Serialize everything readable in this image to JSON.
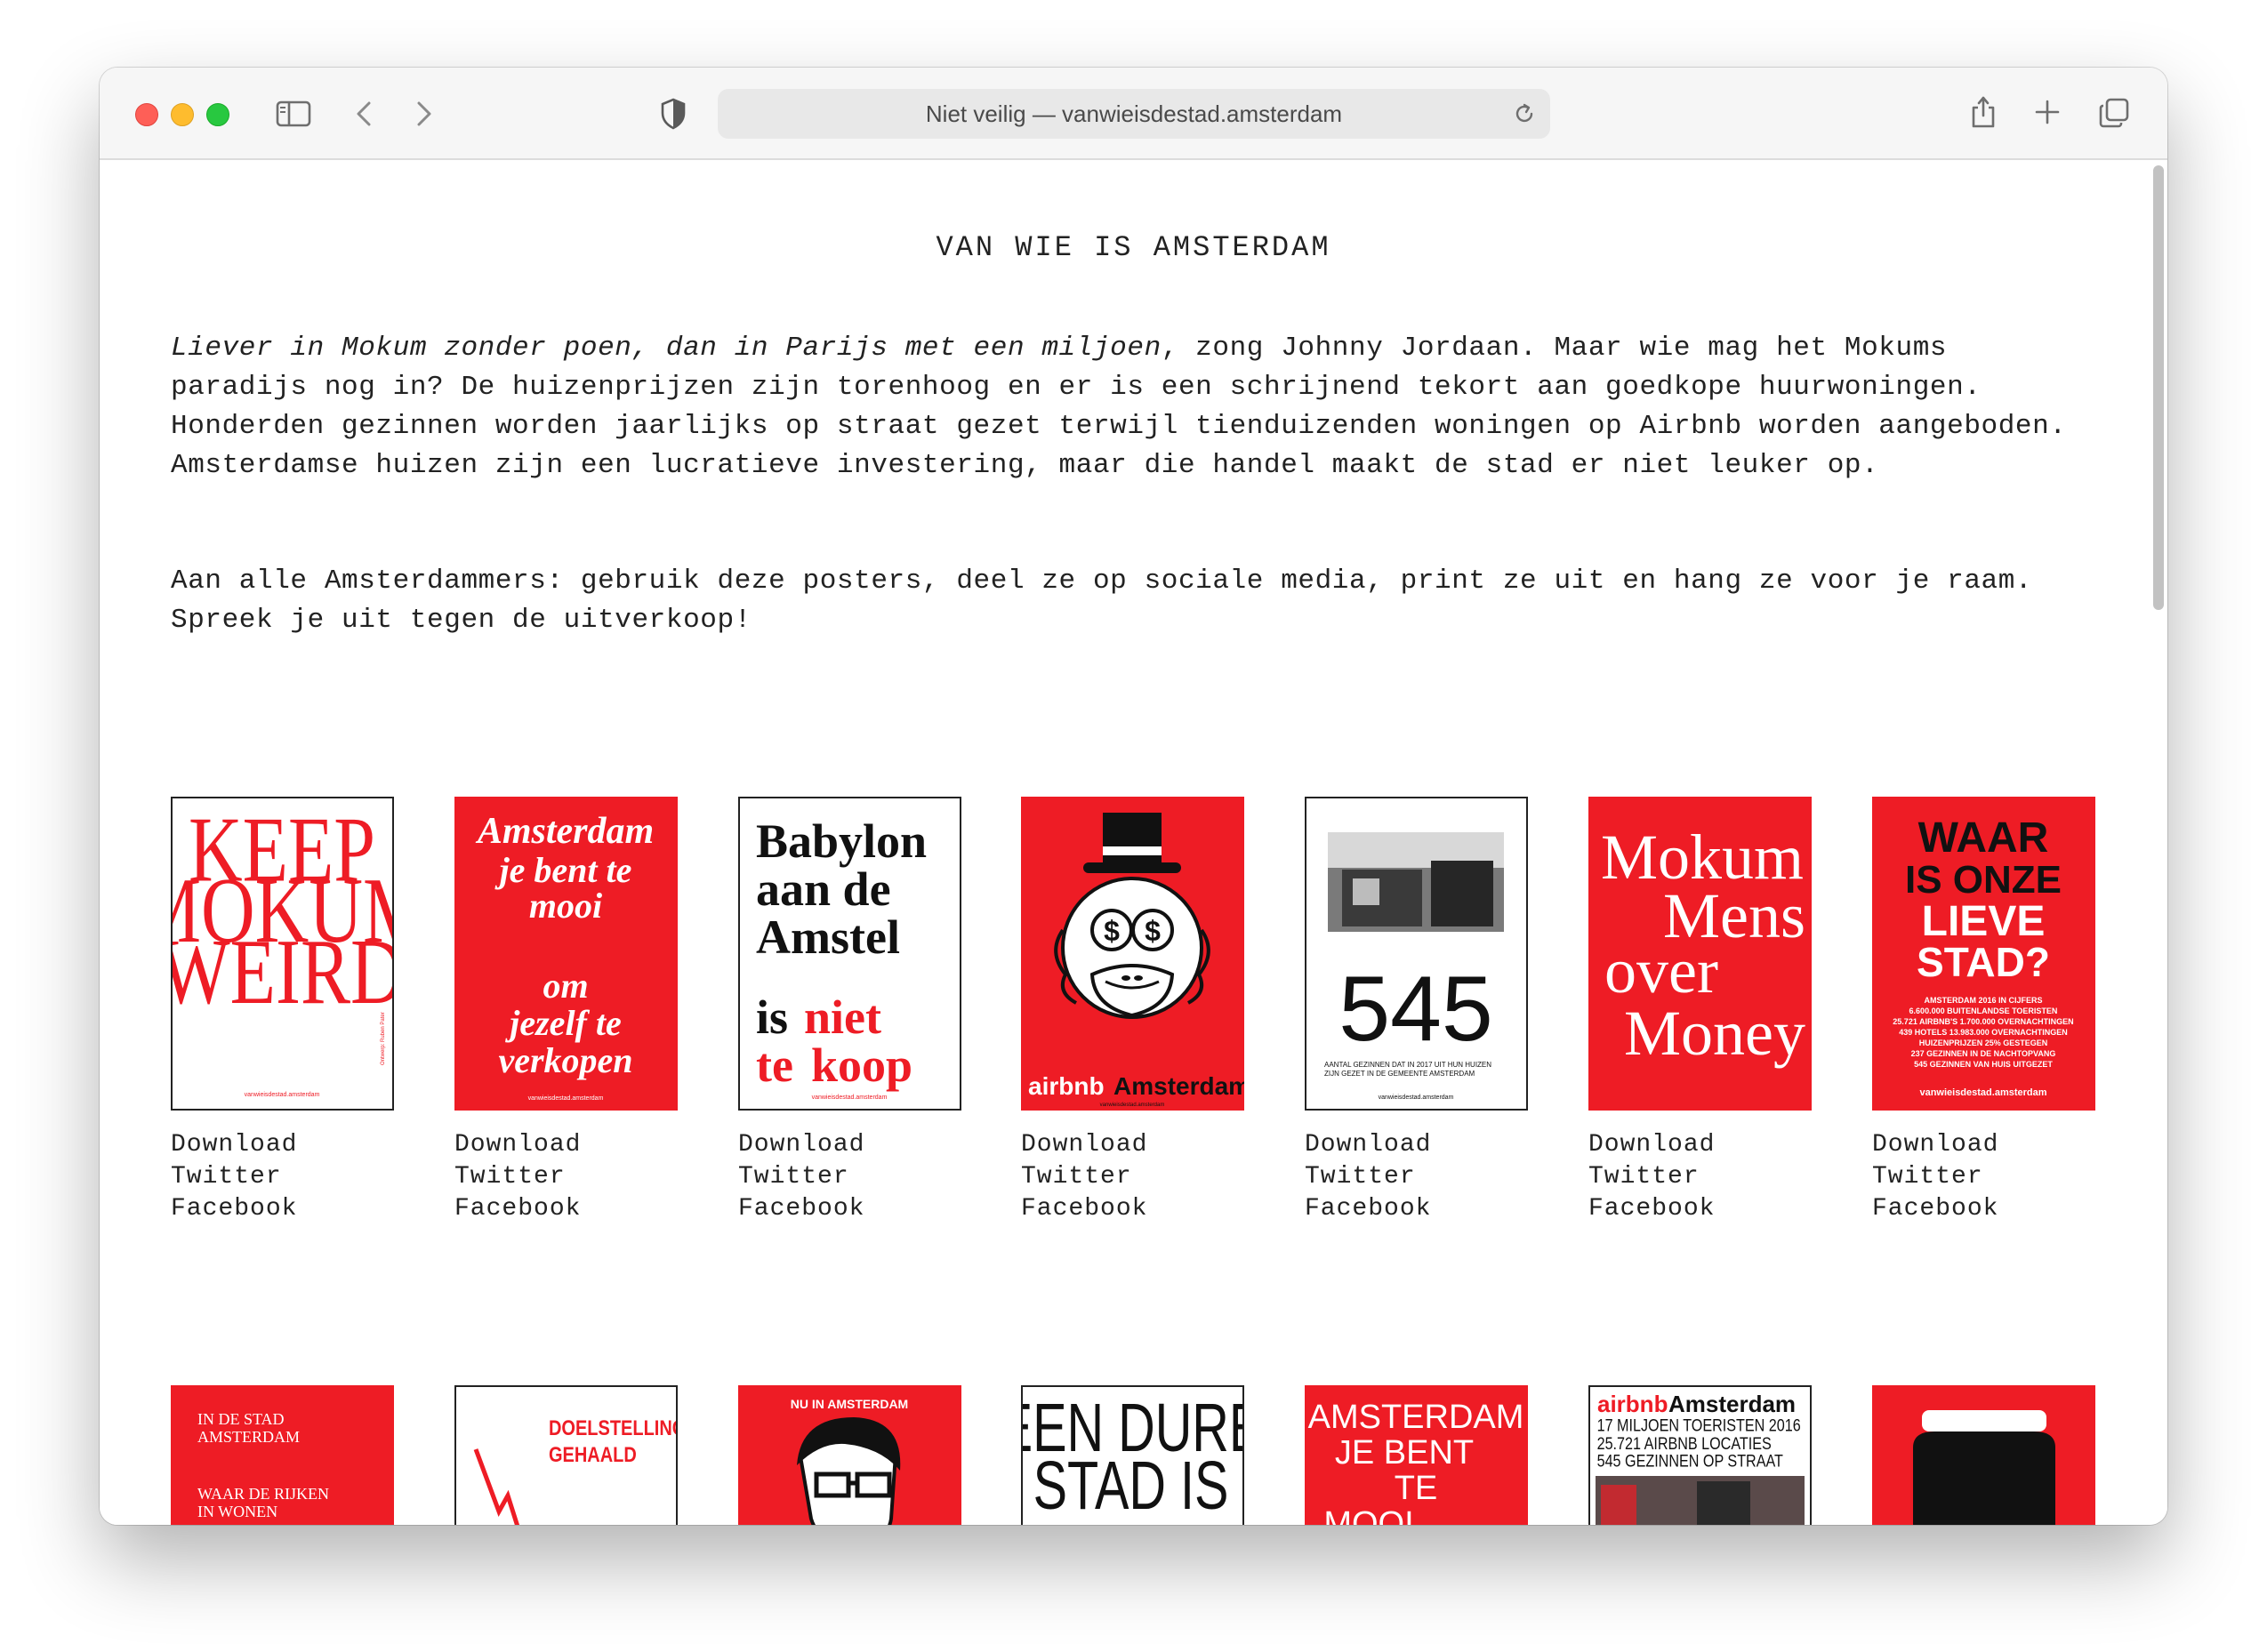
{
  "browser": {
    "address": "Niet veilig — vanwieisdestad.amsterdam",
    "icons": [
      "sidebar-icon",
      "back-icon",
      "forward-icon",
      "privacy-shield-icon",
      "reload-icon",
      "share-icon",
      "new-tab-icon",
      "tab-overview-icon"
    ]
  },
  "site": {
    "title": "VAN WIE IS AMSTERDAM",
    "intro_italic": "Liever in Mokum zonder poen, dan in Parijs met een miljoen",
    "intro_rest": ", zong Johnny Jordaan. Maar wie mag het Mokums paradijs nog in? De huizenprijzen zijn torenhoog en er is een schrijnend tekort aan goedkope huurwoningen. Honderden gezinnen worden jaarlijks op straat gezet terwijl tienduizenden woningen op Airbnb worden aangeboden. Amsterdamse huizen zijn een lucratieve investering, maar die handel maakt de stad er niet leuker op.",
    "intro2": "Aan alle Amsterdammers: gebruik deze posters, deel ze op sociale media, print ze uit en hang ze voor je raam. Spreek je uit tegen de uitverkoop!"
  },
  "links": {
    "download": "Download",
    "twitter": "Twitter",
    "facebook": "Facebook"
  },
  "posters_row1": [
    {
      "lines": [
        "KEEP",
        "MOKUM",
        "WEIRD"
      ],
      "footer": "vanwieisdestad.amsterdam",
      "credit": "Ontwerp: Ruben Pater"
    },
    {
      "lines": [
        "Amsterdam",
        "je bent te",
        "mooi",
        "om",
        "jezelf te",
        "verkopen"
      ],
      "footer": "vanwieisdestad.amsterdam"
    },
    {
      "lines": [
        "Babylon",
        "aan de",
        "Amstel",
        "is",
        "niet",
        "te",
        "koop"
      ],
      "footer": "vanwieisdestad.amsterdam"
    },
    {
      "lines": [
        "airbnb",
        "Amsterdam"
      ],
      "footer": "vanwieisdestad.amsterdam"
    },
    {
      "big": "545",
      "caption": [
        "AANTAL GEZINNEN DAT IN 2017 UIT HUN HUIZEN",
        "ZIJN GEZET IN DE GEMEENTE AMSTERDAM"
      ],
      "footer": "vanwieisdestad.amsterdam"
    },
    {
      "lines": [
        "Mokum",
        "Mens",
        "over",
        "Money"
      ]
    },
    {
      "lines": [
        "WAAR",
        "IS ONZE",
        "LIEVE",
        "STAD?"
      ],
      "facts": [
        "AMSTERDAM 2016 IN CIJFERS",
        "6.600.000 BUITENLANDSE TOERISTEN",
        "25.721 AIRBNB'S 1.700.000 OVERNACHTINGEN",
        "439 HOTELS 13.983.000 OVERNACHTINGEN",
        "HUIZENPRIJZEN 25% GESTEGEN",
        "237 GEZINNEN IN DE NACHTOPVANG",
        "545 GEZINNEN VAN HUIS UITGEZET"
      ],
      "footer": "vanwieisdestad.amsterdam"
    }
  ],
  "posters_row2": [
    {
      "lines": [
        "IN DE STAD",
        "AMSTERDAM",
        "WAAR DE RIJKEN",
        "IN WONEN"
      ]
    },
    {
      "lines": [
        "DOELSTELLING",
        "GEHAALD"
      ]
    },
    {
      "lines": [
        "NU IN AMSTERDAM"
      ]
    },
    {
      "lines": [
        "EEN DURE",
        "STAD IS"
      ]
    },
    {
      "lines": [
        "AMSTERDAM",
        "JE BENT",
        "TE",
        "MOOI"
      ]
    },
    {
      "lines": [
        "airbnb",
        "Amsterdam",
        "17 MILJOEN TOERISTEN 2016",
        "25.721 AIRBNB LOCATIES",
        "545 GEZINNEN OP STRAAT"
      ]
    },
    {
      "lines": []
    }
  ],
  "colors": {
    "poster_red": "#ee1c25",
    "text": "#222222"
  }
}
